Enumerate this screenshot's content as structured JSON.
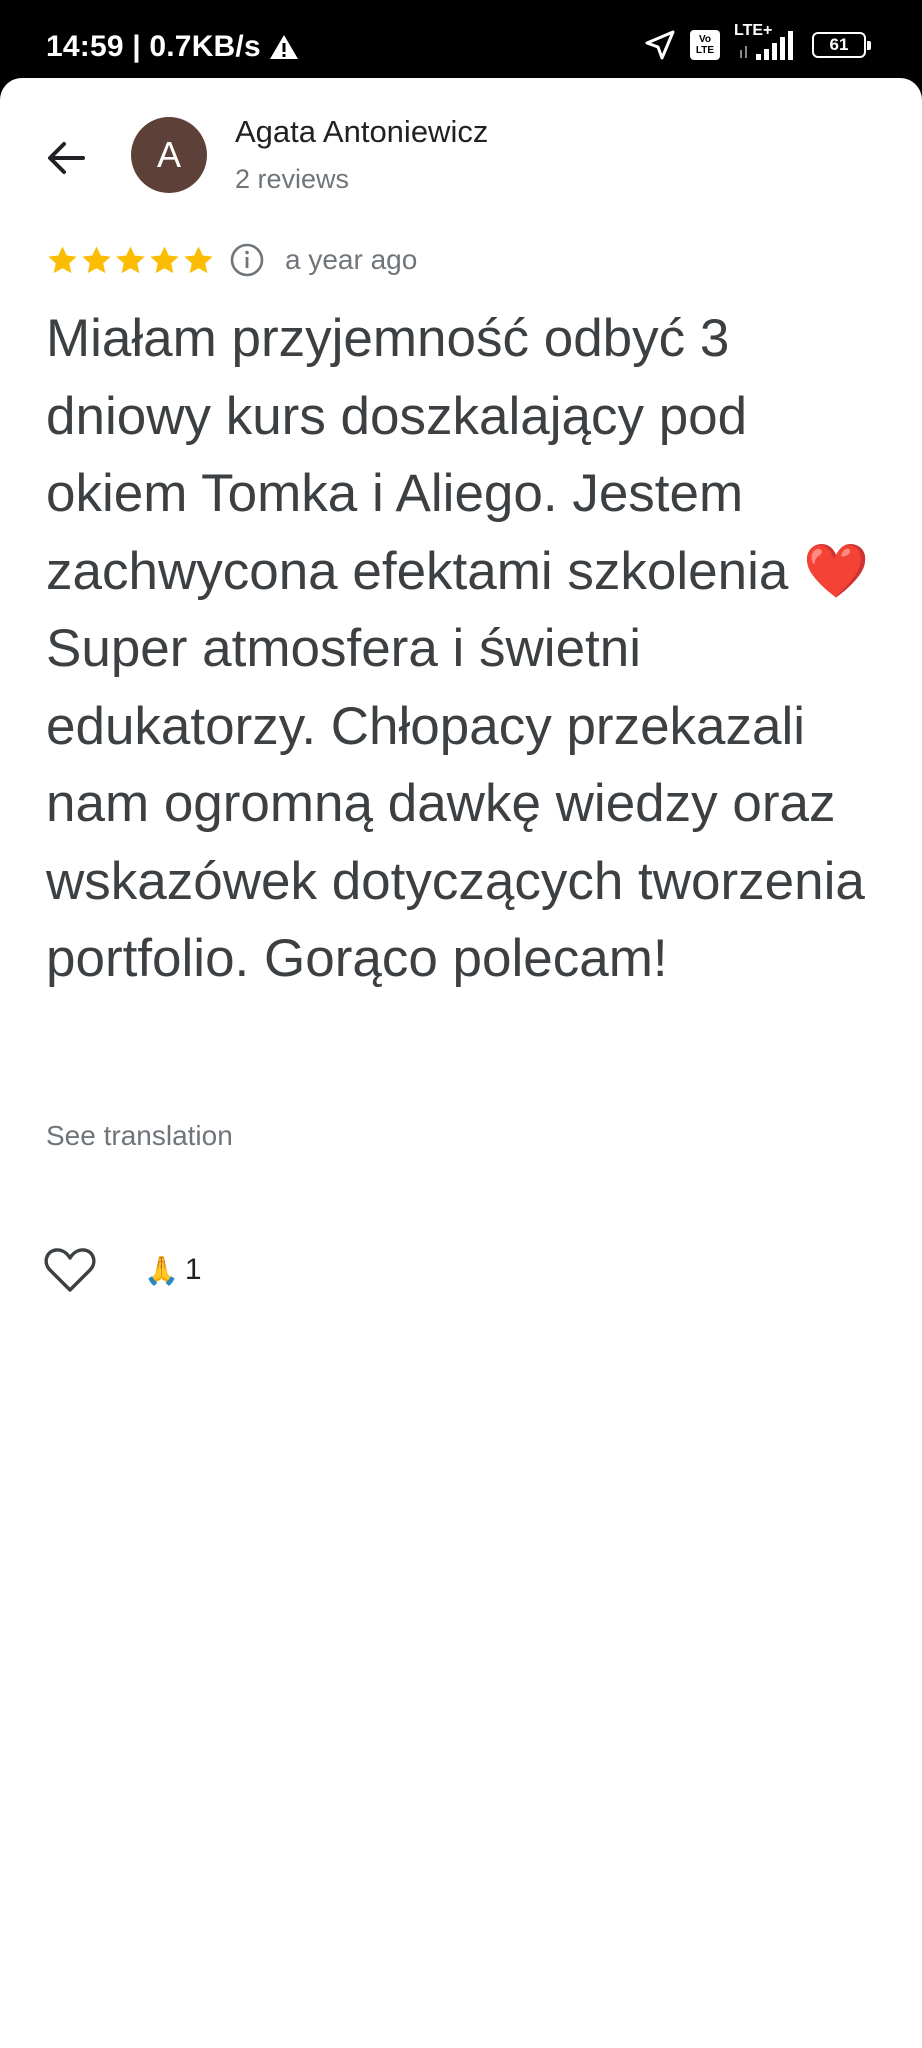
{
  "status_bar": {
    "time_speed": "14:59 | 0.7KB/s",
    "volte_top": "Vo",
    "volte_bottom": "LTE",
    "network": "LTE+",
    "battery": "61"
  },
  "reviewer": {
    "initial": "A",
    "name": "Agata Antoniewicz",
    "review_count": "2 reviews"
  },
  "review": {
    "rating": 5,
    "date": "a year ago",
    "text": "Miałam przyjemność odbyć 3 dniowy kurs doszkalający pod okiem Tomka i Aliego. Jestem zachwycona efektami szkolenia ❤️ Super atmosfera i świetni edukatorzy. Chłopacy przekazali nam ogromną dawkę wiedzy oraz wskazówek dotyczących tworzenia portfolio. Gorąco polecam!",
    "see_translation": "See translation"
  },
  "reactions": {
    "emoji": "🙏",
    "count": "1"
  },
  "colors": {
    "star": "#fbbc04",
    "avatar": "#5d4037",
    "text_primary": "#202124",
    "text_secondary": "#70757a"
  },
  "icons": [
    "back-arrow-icon",
    "star-icon",
    "info-icon",
    "heart-outline-icon",
    "location-arrow-icon",
    "warning-icon",
    "signal-icon"
  ]
}
